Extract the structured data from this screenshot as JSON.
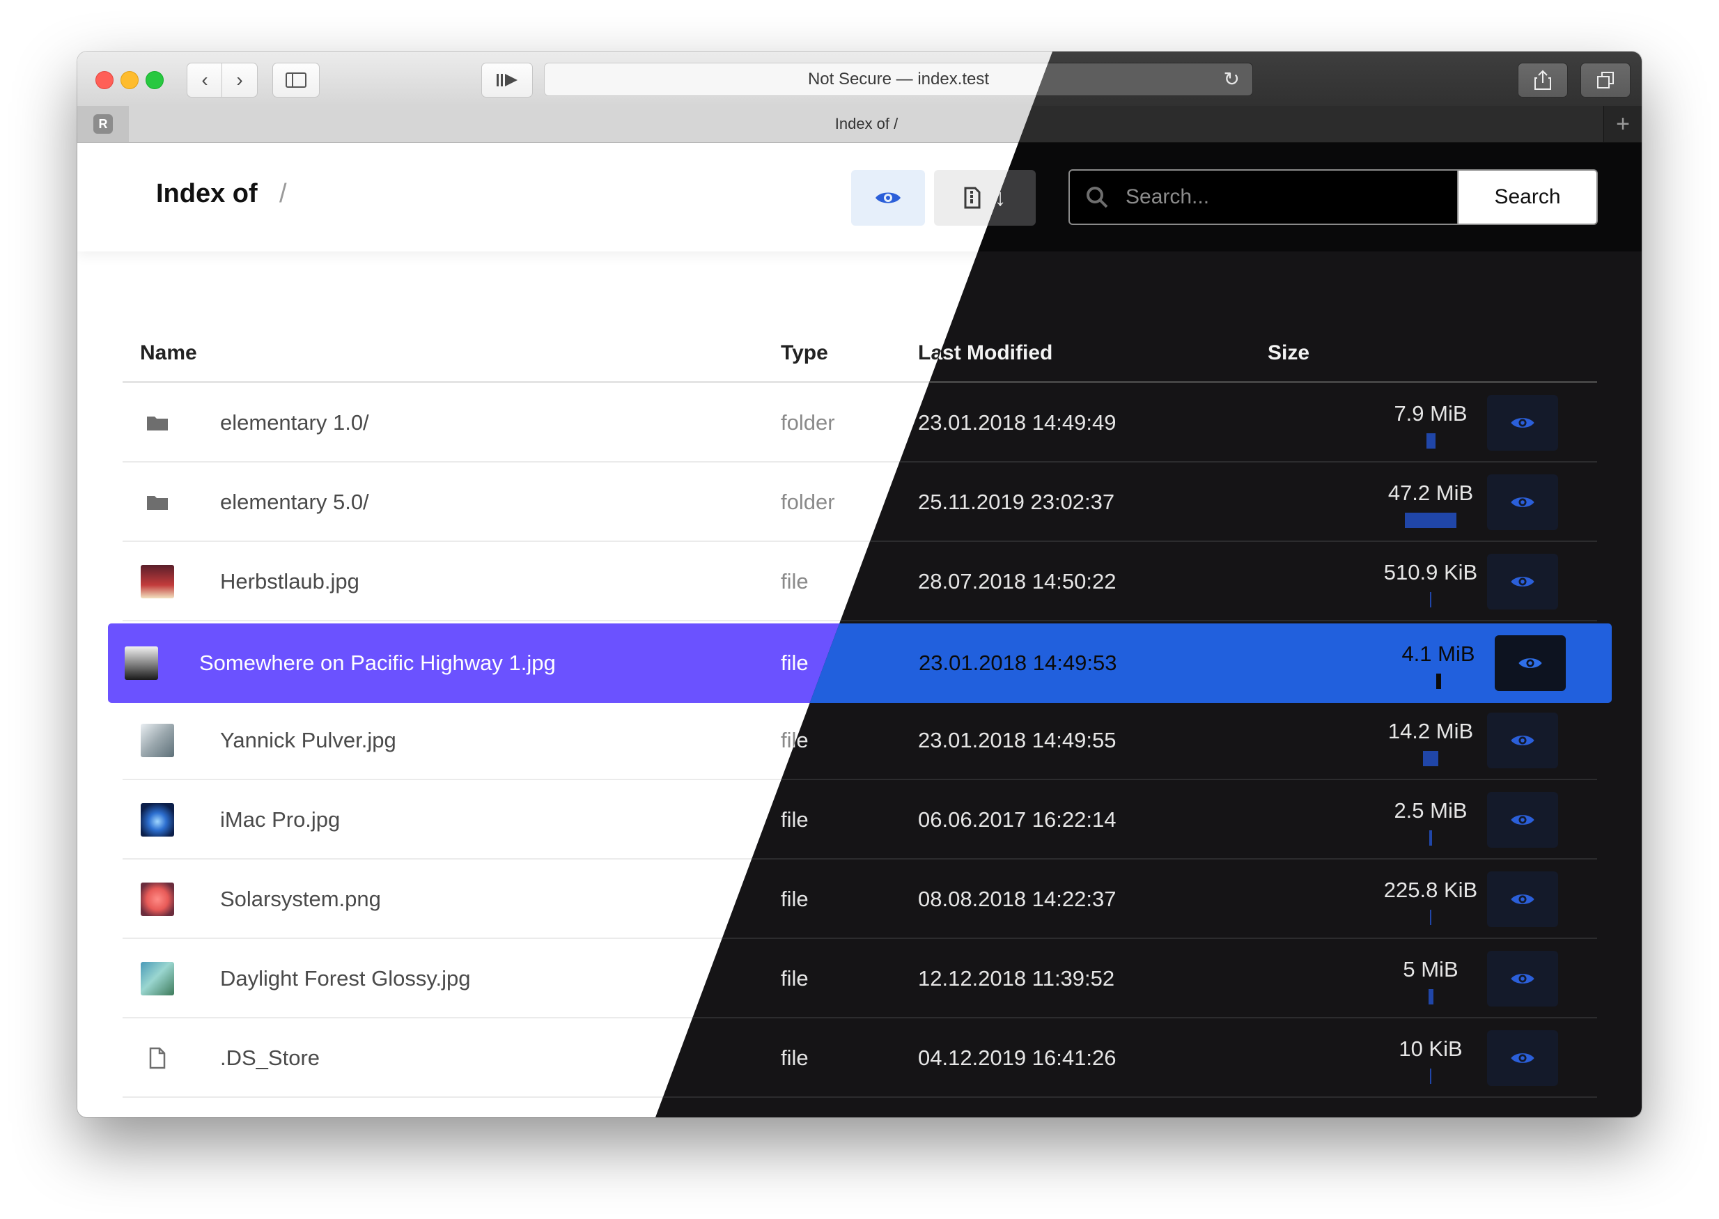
{
  "browser": {
    "address": "Not Secure — index.test",
    "tab_title": "Index of /",
    "pinned_tab": "R",
    "new_tab": "+"
  },
  "header": {
    "title": "Index of",
    "breadcrumb": "/",
    "search_placeholder": "Search...",
    "search_button": "Search"
  },
  "table": {
    "columns": {
      "name": "Name",
      "type": "Type",
      "modified": "Last Modified",
      "size": "Size"
    },
    "rows": [
      {
        "icon": "folder-icon",
        "name": "elementary 1.0/",
        "type": "folder",
        "modified": "23.01.2018 14:49:49",
        "size": "7.9 MiB",
        "size_fraction": 0.17
      },
      {
        "icon": "folder-icon",
        "name": "elementary 5.0/",
        "type": "folder",
        "modified": "25.11.2019 23:02:37",
        "size": "47.2 MiB",
        "size_fraction": 1.0
      },
      {
        "icon": "image-thumbnail",
        "name": "Herbstlaub.jpg",
        "type": "file",
        "modified": "28.07.2018 14:50:22",
        "size": "510.9 KiB",
        "size_fraction": 0.01
      },
      {
        "icon": "image-thumbnail",
        "name": "Somewhere on Pacific Highway 1.jpg",
        "type": "file",
        "modified": "23.01.2018 14:49:53",
        "size": "4.1 MiB",
        "size_fraction": 0.09,
        "active": true
      },
      {
        "icon": "image-thumbnail",
        "name": "Yannick Pulver.jpg",
        "type": "file",
        "modified": "23.01.2018 14:49:55",
        "size": "14.2 MiB",
        "size_fraction": 0.3
      },
      {
        "icon": "image-thumbnail",
        "name": "iMac Pro.jpg",
        "type": "file",
        "modified": "06.06.2017 16:22:14",
        "size": "2.5 MiB",
        "size_fraction": 0.05
      },
      {
        "icon": "image-thumbnail",
        "name": "Solarsystem.png",
        "type": "file",
        "modified": "08.08.2018 14:22:37",
        "size": "225.8 KiB",
        "size_fraction": 0.0
      },
      {
        "icon": "image-thumbnail",
        "name": "Daylight Forest Glossy.jpg",
        "type": "file",
        "modified": "12.12.2018 11:39:52",
        "size": "5 MiB",
        "size_fraction": 0.1
      },
      {
        "icon": "file-icon",
        "name": ".DS_Store",
        "type": "file",
        "modified": "04.12.2019 16:41:26",
        "size": "10 KiB",
        "size_fraction": 0.0
      }
    ]
  },
  "colors": {
    "active_row_light": "#6b52ff",
    "active_row_dark": "#2160dd",
    "accent_blue": "#2046a8",
    "preview_icon": "#2b5fd9"
  }
}
